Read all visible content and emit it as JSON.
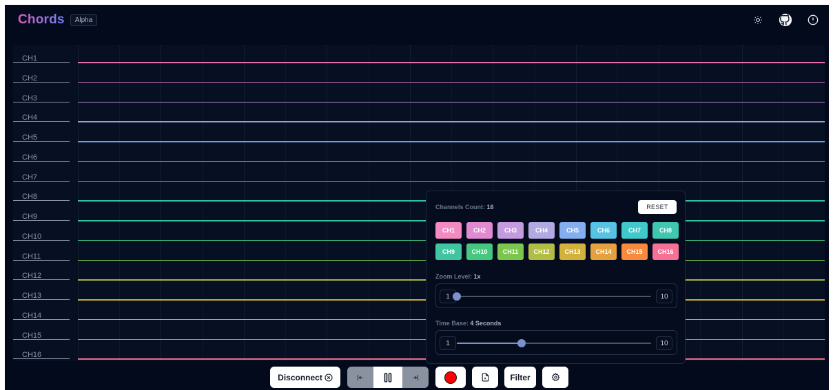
{
  "header": {
    "app_name": "Chords",
    "badge": "Alpha",
    "icons": [
      "sun-icon",
      "github-icon",
      "info-icon"
    ]
  },
  "plot": {
    "channels": [
      {
        "label": "CH1",
        "color": "#e56fb0"
      },
      {
        "label": "CH2",
        "color": "#d873c6"
      },
      {
        "label": "CH3",
        "color": "#b989d6"
      },
      {
        "label": "CH4",
        "color": "#a59bd6"
      },
      {
        "label": "CH5",
        "color": "#6ea2e2"
      },
      {
        "label": "CH6",
        "color": "#45b8d8"
      },
      {
        "label": "CH7",
        "color": "#2fbfc0"
      },
      {
        "label": "CH8",
        "color": "#31c0a6"
      },
      {
        "label": "CH9",
        "color": "#36c09d"
      },
      {
        "label": "CH10",
        "color": "#3cc07a"
      },
      {
        "label": "CH11",
        "color": "#70c04a"
      },
      {
        "label": "CH12",
        "color": "#a8b640"
      },
      {
        "label": "CH13",
        "color": "#c8ac38"
      },
      {
        "label": "CH14",
        "color": "#db9a3c"
      },
      {
        "label": "CH15",
        "color": "#f0873e"
      },
      {
        "label": "CH16",
        "color": "#ef6a8b"
      }
    ]
  },
  "panel": {
    "channels_count_label": "Channels Count:",
    "channels_count_value": "16",
    "reset_label": "RESET",
    "buttons": [
      {
        "label": "CH1",
        "color": "#f58ac2"
      },
      {
        "label": "CH2",
        "color": "#e28ad1"
      },
      {
        "label": "CH3",
        "color": "#c59be0"
      },
      {
        "label": "CH4",
        "color": "#b0a9e2"
      },
      {
        "label": "CH5",
        "color": "#84aef0"
      },
      {
        "label": "CH6",
        "color": "#56c3e4"
      },
      {
        "label": "CH7",
        "color": "#3fc9cc"
      },
      {
        "label": "CH8",
        "color": "#41c7b0"
      },
      {
        "label": "CH9",
        "color": "#42c4a0"
      },
      {
        "label": "CH10",
        "color": "#46c77f"
      },
      {
        "label": "CH11",
        "color": "#7ac64f"
      },
      {
        "label": "CH12",
        "color": "#b1bd44"
      },
      {
        "label": "CH13",
        "color": "#d2b23c"
      },
      {
        "label": "CH14",
        "color": "#e5a03f"
      },
      {
        "label": "CH15",
        "color": "#f78a3f"
      },
      {
        "label": "CH16",
        "color": "#f77197"
      }
    ],
    "zoom": {
      "label": "Zoom Level:",
      "value_label": "1x",
      "min": "1",
      "max": "10",
      "value": 1
    },
    "timebase": {
      "label": "Time Base:",
      "value_label": "4 Seconds",
      "min": "1",
      "max": "10",
      "value": 4
    }
  },
  "toolbar": {
    "disconnect_label": "Disconnect",
    "filter_label": "Filter",
    "record_color": "#ff0000"
  }
}
